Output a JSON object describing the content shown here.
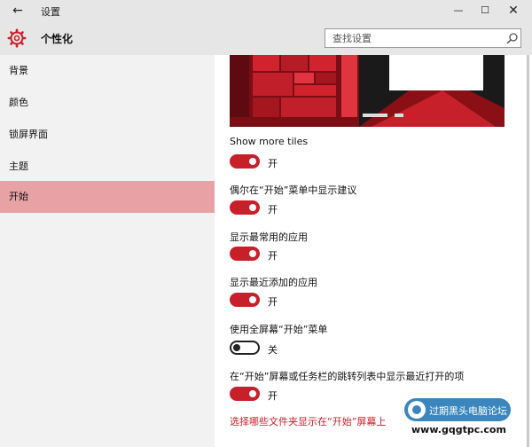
{
  "window": {
    "title": "设置",
    "back_icon": "back-arrow-icon",
    "controls": [
      "minimize",
      "maximize",
      "close"
    ]
  },
  "header": {
    "icon": "gear-icon",
    "title": "个性化",
    "search_placeholder": "查找设置",
    "search_icon": "search-icon"
  },
  "sidebar": {
    "items": [
      {
        "label": "背景"
      },
      {
        "label": "颜色"
      },
      {
        "label": "锁屏界面"
      },
      {
        "label": "主题"
      },
      {
        "label": "开始",
        "selected": true
      }
    ]
  },
  "settings": [
    {
      "label": "Show more tiles",
      "state": "开",
      "on": true
    },
    {
      "label": "偶尔在“开始”菜单中显示建议",
      "state": "开",
      "on": true
    },
    {
      "label": "显示最常用的应用",
      "state": "开",
      "on": true
    },
    {
      "label": "显示最近添加的应用",
      "state": "开",
      "on": true
    },
    {
      "label": "使用全屏幕“开始”菜单",
      "state": "关",
      "on": false
    },
    {
      "label": "在“开始”屏幕或任务栏的跳转列表中显示最近打开的项",
      "state": "开",
      "on": true
    }
  ],
  "link": "选择哪些文件夹显示在“开始”屏幕上",
  "watermark": {
    "text": "过期黑头电脑论坛",
    "url": "www.gqgtpc.com"
  },
  "colors": {
    "accent": "#c8202b",
    "selected_nav": "#e8a2a6",
    "chrome": "#e6e6e6",
    "sidebar": "#f2f2f2"
  }
}
